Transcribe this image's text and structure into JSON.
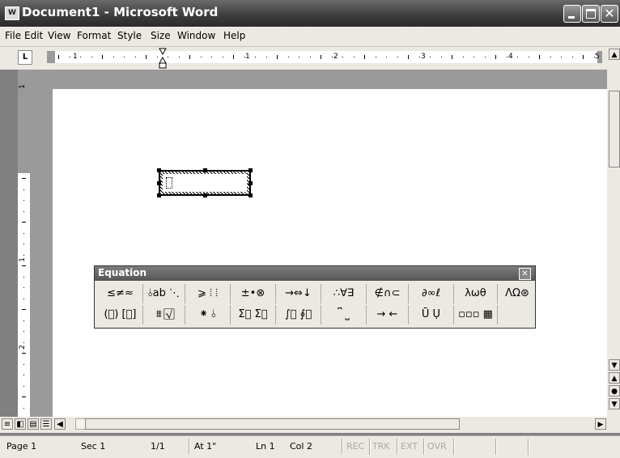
{
  "window": {
    "title": "Document1 - Microsoft Word",
    "icon": "word-document-icon"
  },
  "menu": [
    "File",
    "Edit",
    "View",
    "Format",
    "Style",
    "Size",
    "Window",
    "Help"
  ],
  "ruler": {
    "numbers": [
      "1",
      "1",
      "2",
      "3",
      "4",
      "5"
    ],
    "vnumbers": [
      "1",
      "1",
      "2"
    ],
    "tab_selector": "L"
  },
  "equation_toolbar": {
    "title": "Equation",
    "row1": [
      "≤≠≈",
      "⫰ab ⋱",
      "⩾ ⦙ ⦙",
      "±•⊗",
      "→⇔↓",
      "∴∀∃",
      "∉∩⊂",
      "∂∞ℓ",
      "λωθ",
      "ΛΩ⊛"
    ],
    "row2": [
      "(⃞) [⃞]",
      "⩩ √⃞",
      "⁕ ⫰",
      "Σ⃞ Σ⃞",
      "∫⃞ ∮⃞",
      "⎴ ⎵",
      "→ ←",
      "Ū Ụ",
      "▫▫▫ ▦"
    ]
  },
  "status": {
    "page": "Page 1",
    "sec": "Sec 1",
    "pages": "1/1",
    "at": "At 1\"",
    "ln": "Ln 1",
    "col": "Col 2",
    "rec": "REC",
    "trk": "TRK",
    "ext": "EXT",
    "ovr": "OVR"
  }
}
